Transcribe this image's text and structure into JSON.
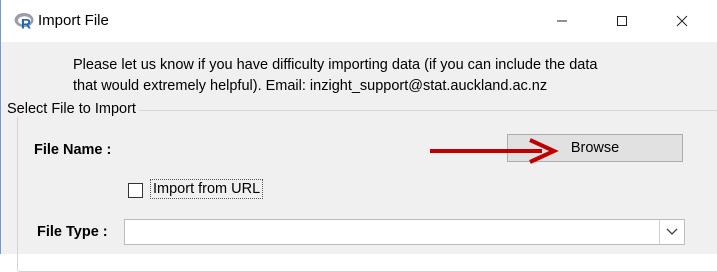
{
  "window": {
    "title": "Import File",
    "icon": "r-logo-icon",
    "controls": [
      "minimize-icon",
      "maximize-icon",
      "close-icon"
    ]
  },
  "info": {
    "line1": "Please let us know if you have difficulty importing data (if you can include the data",
    "line2": "that would extremely helpful). Email: inzight_support@stat.auckland.ac.nz"
  },
  "group": {
    "title": "Select File to Import"
  },
  "file_name": {
    "label": "File Name :",
    "browse_label": "Browse"
  },
  "import_url": {
    "label": "Import from URL",
    "checked": false
  },
  "file_type": {
    "label": "File Type :",
    "value": ""
  },
  "colors": {
    "annotation_arrow": "#c00000",
    "window_border": "#6f9bd2"
  }
}
